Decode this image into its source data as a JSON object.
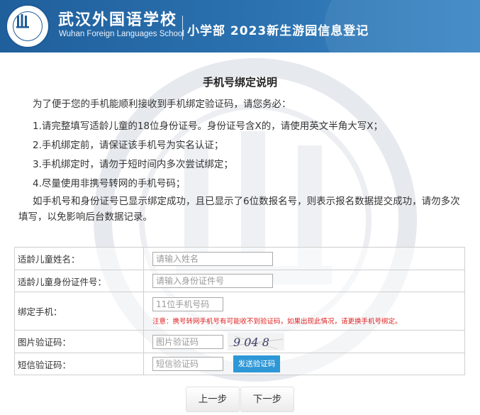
{
  "header": {
    "school_name_cn": "武汉外国语学校",
    "school_name_en": "Wuhan Foreign Languages School",
    "subtitle": "小学部 2023新生游园信息登记",
    "logo_ring_text": "武汉外国语学校"
  },
  "instructions": {
    "title": "手机号绑定说明",
    "intro": "为了便于您的手机能顺利接收到手机绑定验证码，请您务必：",
    "items": [
      "1.请完整填写适龄儿童的18位身份证号。身份证号含X的，请使用英文半角大写X；",
      "2.手机绑定前，请保证该手机号为实名认证；",
      "3.手机绑定时，请勿于短时间内多次尝试绑定；",
      "4.尽量使用非携号转网的手机号码；"
    ],
    "outro": "如手机号和身份证号已显示绑定成功，且已显示了6位数报名号，则表示报名数据提交成功，请勿多次填写，以免影响后台数据记录。"
  },
  "form": {
    "child_name_label": "适龄儿童姓名：",
    "child_name_placeholder": "请输入姓名",
    "child_id_label": "适龄儿童身份证件号：",
    "child_id_placeholder": "请输入身份证件号",
    "phone_label": "绑定手机：",
    "phone_placeholder": "11位手机号码",
    "phone_note": "注意：携号转网手机号有可能收不到验证码，如果出现此情况，请更换手机号绑定。",
    "captcha_label": "图片验证码：",
    "captcha_placeholder": "图片验证码",
    "captcha_text": "9 04 8",
    "sms_label": "短信验证码：",
    "sms_placeholder": "短信验证码",
    "sms_button": "发送验证码"
  },
  "nav": {
    "prev": "上一步",
    "next": "下一步"
  },
  "colors": {
    "banner": "#2c72b0",
    "note": "#e02020",
    "sms_button": "#2e97d6"
  }
}
